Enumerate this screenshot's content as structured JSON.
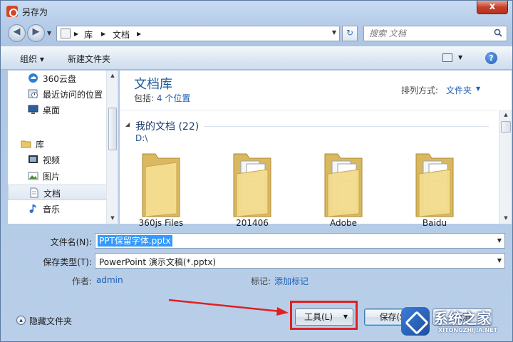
{
  "window": {
    "title": "另存为",
    "close_label": "x"
  },
  "address": {
    "crumbs": [
      "库",
      "文档"
    ]
  },
  "search": {
    "placeholder": "搜索 文档"
  },
  "toolbar": {
    "organize": "组织 ▾",
    "new_folder": "新建文件夹"
  },
  "sidebar": {
    "items": [
      {
        "label": "360云盘",
        "icon": "cloud-icon"
      },
      {
        "label": "最近访问的位置",
        "icon": "recent-places-icon"
      },
      {
        "label": "桌面",
        "icon": "desktop-icon"
      },
      {
        "label": "库",
        "icon": "library-icon"
      },
      {
        "label": "视频",
        "icon": "video-icon"
      },
      {
        "label": "图片",
        "icon": "picture-icon"
      },
      {
        "label": "文档",
        "icon": "document-icon",
        "selected": true
      },
      {
        "label": "音乐",
        "icon": "music-icon"
      }
    ]
  },
  "library": {
    "title": "文档库",
    "includes_label": "包括:",
    "includes_value": "4 个位置",
    "arrange_label": "排列方式:",
    "arrange_value": "文件夹"
  },
  "group": {
    "title": "我的文档 (22)",
    "path": "D:\\"
  },
  "folders": [
    {
      "name": "360js Files"
    },
    {
      "name": "201406"
    },
    {
      "name": "Adobe"
    },
    {
      "name": "Baidu"
    }
  ],
  "form": {
    "filename_label": "文件名(N):",
    "filename_value": "PPT保留字体.pptx",
    "filetype_label": "保存类型(T):",
    "filetype_value": "PowerPoint 演示文稿(*.pptx)",
    "author_label": "作者:",
    "author_value": "admin",
    "tags_label": "标记:",
    "tags_value": "添加标记"
  },
  "footer": {
    "hide_folders": "隐藏文件夹",
    "tools": "工具(L)",
    "save": "保存(S)",
    "cancel": "取消"
  },
  "watermark": {
    "text": "系统之家",
    "sub": "XITONGZHIJIA.NET"
  }
}
